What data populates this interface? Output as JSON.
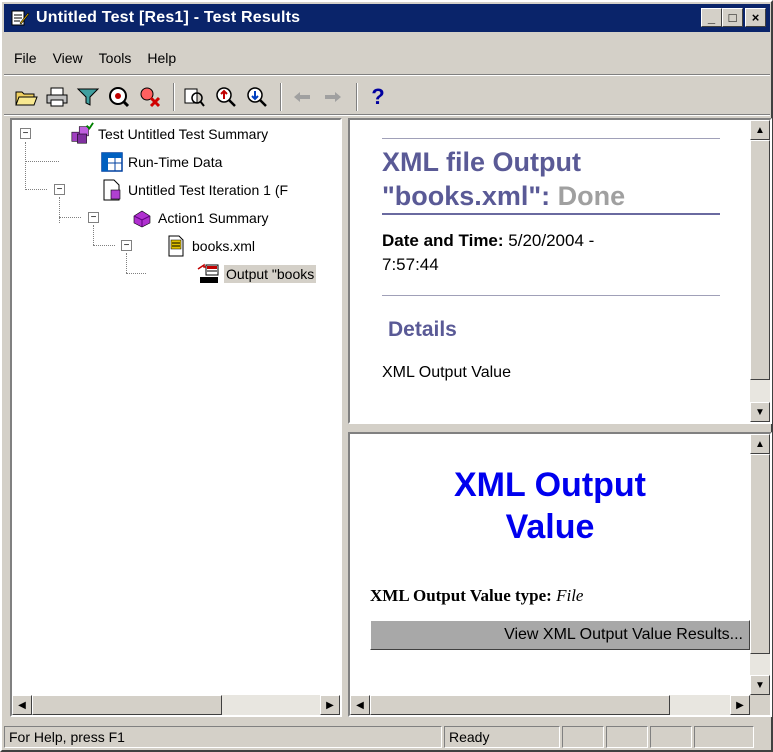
{
  "window": {
    "title": "Untitled Test [Res1] - Test Results",
    "minimize_symbol": "_",
    "maximize_symbol": "□",
    "close_symbol": "×"
  },
  "menu": {
    "items": [
      "File",
      "View",
      "Tools",
      "Help"
    ]
  },
  "toolbar": {
    "tools": [
      {
        "name": "open-icon"
      },
      {
        "name": "print-icon"
      },
      {
        "name": "filter-icon"
      },
      {
        "name": "find-icon"
      },
      {
        "name": "delete-icon"
      },
      {
        "name": "zoom-icon"
      },
      {
        "name": "zoom-in-icon"
      },
      {
        "name": "zoom-out-icon"
      },
      {
        "name": "back-arrow-icon",
        "disabled": true
      },
      {
        "name": "forward-arrow-icon",
        "disabled": true
      },
      {
        "name": "help-icon"
      }
    ],
    "help_glyph": "?"
  },
  "tree": {
    "nodes": [
      {
        "label": "Test Untitled Test Summary",
        "level": 0,
        "expander": "−",
        "icon": "test-summary-icon"
      },
      {
        "label": "Run-Time Data",
        "level": 1,
        "expander": "",
        "icon": "run-time-data-icon"
      },
      {
        "label": "Untitled Test Iteration 1 (F",
        "level": 1,
        "expander": "−",
        "icon": "iteration-icon"
      },
      {
        "label": "Action1 Summary",
        "level": 2,
        "expander": "−",
        "icon": "action-icon"
      },
      {
        "label": "books.xml",
        "level": 3,
        "expander": "−",
        "icon": "xml-file-icon"
      },
      {
        "label": "Output \"books",
        "level": 4,
        "expander": "",
        "icon": "xml-output-icon",
        "selected": true
      }
    ]
  },
  "result": {
    "heading_part1": "XML file Output",
    "heading_part2": "\"books.xml\":",
    "heading_status": "Done",
    "date_label": "Date and Time:",
    "date_value": "5/20/2004 -",
    "time_value": "7:57:44",
    "details_label": "Details",
    "output_label": "XML Output Value"
  },
  "detail": {
    "title_line1": "XML Output",
    "title_line2": "Value",
    "type_label": "XML Output Value type:",
    "type_value": "File",
    "view_button": "View XML Output Value Results..."
  },
  "status": {
    "help_text": "For Help, press F1",
    "state": "Ready"
  }
}
